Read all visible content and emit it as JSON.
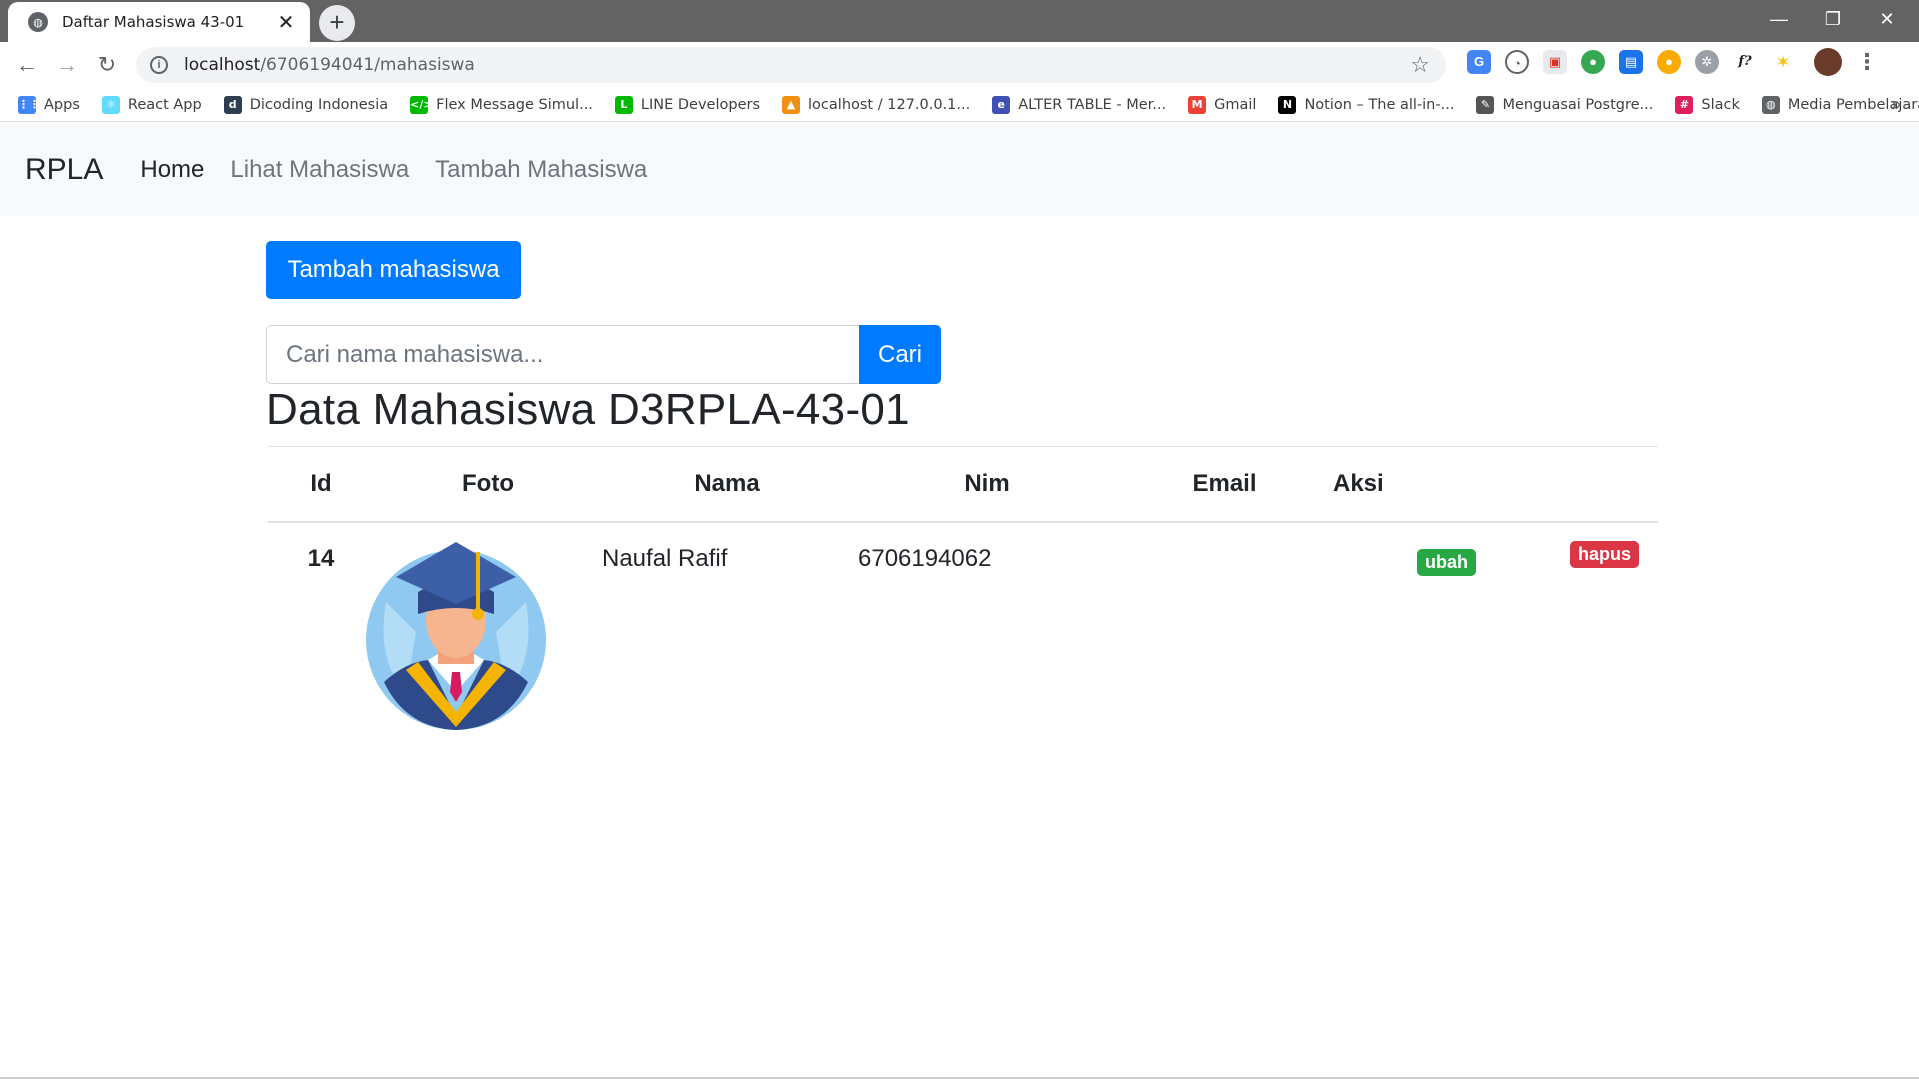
{
  "browser": {
    "tab_title": "Daftar Mahasiswa 43-01",
    "url_host": "localhost",
    "url_path": "/6706194041/mahasiswa",
    "bookmarks": [
      {
        "label": "Apps",
        "icon": "apps-grid-icon",
        "color": "#4285f4"
      },
      {
        "label": "React App",
        "icon": "react-icon",
        "color": "#61dafb"
      },
      {
        "label": "Dicoding Indonesia",
        "icon": "dicoding-icon",
        "color": "#2d3e50"
      },
      {
        "label": "Flex Message Simul...",
        "icon": "code-icon",
        "color": "#00b900"
      },
      {
        "label": "LINE Developers",
        "icon": "line-icon",
        "color": "#00b900"
      },
      {
        "label": "localhost / 127.0.0.1...",
        "icon": "phpmyadmin-icon",
        "color": "#f29111"
      },
      {
        "label": "ALTER TABLE - Mer...",
        "icon": "w3-icon",
        "color": "#3f51b5"
      },
      {
        "label": "Gmail",
        "icon": "gmail-icon",
        "color": "#ea4335"
      },
      {
        "label": "Notion – The all-in-...",
        "icon": "notion-icon",
        "color": "#000000"
      },
      {
        "label": "Menguasai Postgre...",
        "icon": "leaf-icon",
        "color": "#555555"
      },
      {
        "label": "Slack",
        "icon": "slack-icon",
        "color": "#e01e5a"
      },
      {
        "label": "Media Pembelajaran",
        "icon": "globe-icon",
        "color": "#5f6368"
      }
    ]
  },
  "navbar": {
    "brand": "RPLA",
    "links": [
      "Home",
      "Lihat Mahasiswa",
      "Tambah Mahasiswa"
    ]
  },
  "actions": {
    "add_button": "Tambah mahasiswa",
    "search_placeholder": "Cari nama mahasiswa...",
    "search_button": "Cari"
  },
  "title": "Data Mahasiswa D3RPLA-43-01",
  "table": {
    "headers": [
      "Id",
      "Foto",
      "Nama",
      "Nim",
      "Email",
      "Aksi"
    ],
    "rows": [
      {
        "id": "14",
        "nama": "Naufal Rafif",
        "nim": "6706194062",
        "email": "",
        "edit": "ubah",
        "delete": "hapus"
      }
    ]
  },
  "colors": {
    "primary": "#007bff",
    "success": "#28a745",
    "danger": "#dc3545",
    "navbar_bg": "#f8f9fa"
  }
}
